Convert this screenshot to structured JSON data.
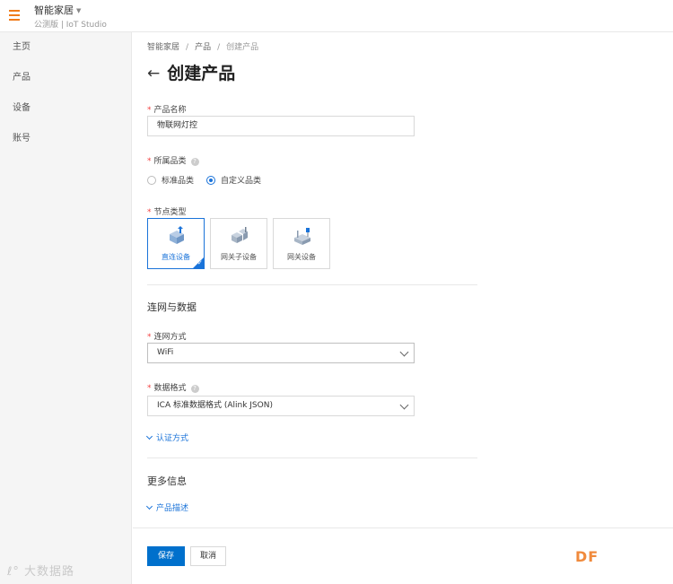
{
  "header": {
    "project_title": "智能家居",
    "project_subtitle": "公测版 | IoT Studio"
  },
  "sidebar": {
    "items": [
      {
        "label": "主页"
      },
      {
        "label": "产品"
      },
      {
        "label": "设备"
      },
      {
        "label": "账号"
      }
    ]
  },
  "breadcrumb": [
    "智能家居",
    "产品",
    "创建产品"
  ],
  "page": {
    "title": "创建产品"
  },
  "form": {
    "product_name": {
      "label": "产品名称",
      "value": "物联网灯控"
    },
    "category": {
      "label": "所属品类",
      "options": [
        {
          "label": "标准品类",
          "checked": false
        },
        {
          "label": "自定义品类",
          "checked": true
        }
      ]
    },
    "node_type": {
      "label": "节点类型",
      "options": [
        {
          "label": "直连设备",
          "icon": "direct-device-icon",
          "selected": true
        },
        {
          "label": "网关子设备",
          "icon": "gateway-subdevice-icon",
          "selected": false
        },
        {
          "label": "网关设备",
          "icon": "gateway-device-icon",
          "selected": false
        }
      ]
    },
    "network_section_title": "连网与数据",
    "network_method": {
      "label": "连网方式",
      "value": "WiFi"
    },
    "data_format": {
      "label": "数据格式",
      "value": "ICA 标准数据格式 (Alink JSON)"
    },
    "auth_toggle": "认证方式",
    "more_section_title": "更多信息",
    "description_toggle": "产品描述"
  },
  "actions": {
    "save": "保存",
    "cancel": "取消"
  },
  "watermarks": {
    "left": "大数据路",
    "right": "DF"
  },
  "colors": {
    "accent": "#0070cc",
    "menu_icon": "#f07c1b",
    "required": "#f24141",
    "brand_df": "#f08a3c"
  }
}
